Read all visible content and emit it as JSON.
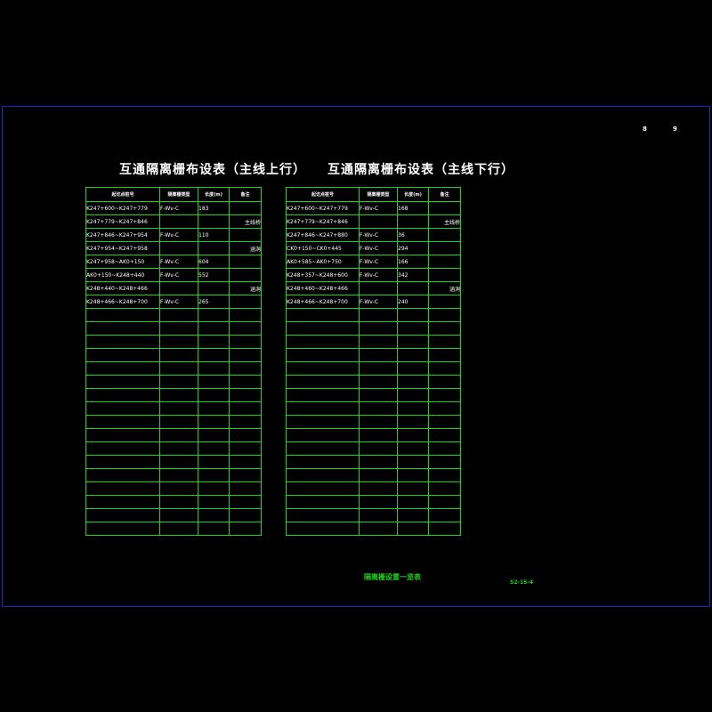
{
  "page_marks": [
    "8",
    "9"
  ],
  "tables": [
    {
      "title": "互通隔离栅布设表（主线上行）",
      "headers": [
        "起讫点桩号",
        "隔离栅类型",
        "长度(m)",
        "备注"
      ],
      "rows": [
        [
          "K247+600~K247+779",
          "F-Wv-C",
          "183",
          ""
        ],
        [
          "K247+779~K247+846",
          "",
          "",
          "主线桥"
        ],
        [
          "K247+846~K247+954",
          "F-Wv-C",
          "110",
          ""
        ],
        [
          "K247+954~K247+958",
          "",
          "",
          "涵洞"
        ],
        [
          "K247+958~AK0+150",
          "F-Wv-C",
          "604",
          ""
        ],
        [
          "AK0+150~K248+440",
          "F-Wv-C",
          "552",
          ""
        ],
        [
          "K248+440~K248+466",
          "",
          "",
          "涵洞"
        ],
        [
          "K248+466~K248+700",
          "F-Wv-C",
          "265",
          ""
        ]
      ],
      "empty_rows": 17
    },
    {
      "title": "互通隔离栅布设表（主线下行）",
      "headers": [
        "起讫点桩号",
        "隔离栅类型",
        "长度(m)",
        "备注"
      ],
      "rows": [
        [
          "K247+600~K247+779",
          "F-Wv-C",
          "168",
          ""
        ],
        [
          "K247+779~K247+846",
          "",
          "",
          "主线桥"
        ],
        [
          "K247+846~K247+880",
          "F-Wv-C",
          "36",
          ""
        ],
        [
          "CK0+150~CK0+445",
          "F-Wv-C",
          "294",
          ""
        ],
        [
          "AK0+585~AK0+750",
          "F-Wv-C",
          "166",
          ""
        ],
        [
          "K248+357~K248+600",
          "F-Wv-C",
          "342",
          ""
        ],
        [
          "K248+460~K248+466",
          "",
          "",
          "涵洞"
        ],
        [
          "K248+466~K248+700",
          "F-Wv-C",
          "240",
          ""
        ]
      ],
      "empty_rows": 17
    }
  ],
  "footer": {
    "title": "隔离栅设置一览表",
    "drawing_no": "S2-15-4"
  },
  "colors": {
    "background": "#000000",
    "frame": "#2323c8",
    "grid": "#1ed21e",
    "text": "#ffffff",
    "footer": "#1ed21e"
  }
}
